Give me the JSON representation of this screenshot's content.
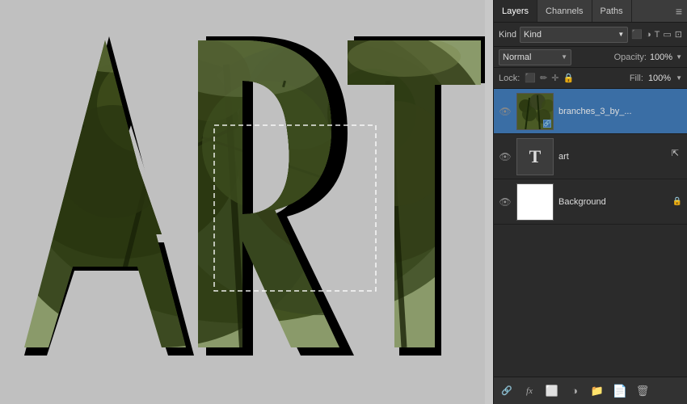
{
  "panel": {
    "tabs": [
      {
        "label": "Layers",
        "active": true
      },
      {
        "label": "Channels",
        "active": false
      },
      {
        "label": "Paths",
        "active": false
      }
    ],
    "kind_label": "Kind",
    "kind_value": "Kind",
    "blend_mode": "Normal",
    "opacity_label": "Opacity:",
    "opacity_value": "100%",
    "lock_label": "Lock:",
    "fill_label": "Fill:",
    "fill_value": "100%",
    "layers": [
      {
        "id": "branches",
        "name": "branches_3_by_...",
        "type": "image",
        "visible": true,
        "selected": true
      },
      {
        "id": "art-text",
        "name": "art",
        "type": "text",
        "visible": true,
        "selected": false
      },
      {
        "id": "background",
        "name": "Background",
        "type": "fill",
        "visible": true,
        "selected": false,
        "locked": true
      }
    ],
    "bottom_icons": [
      "go-to-link",
      "fx",
      "mask",
      "adjustment",
      "folder",
      "new-layer",
      "trash"
    ]
  },
  "canvas": {
    "art_letters": "ART"
  }
}
